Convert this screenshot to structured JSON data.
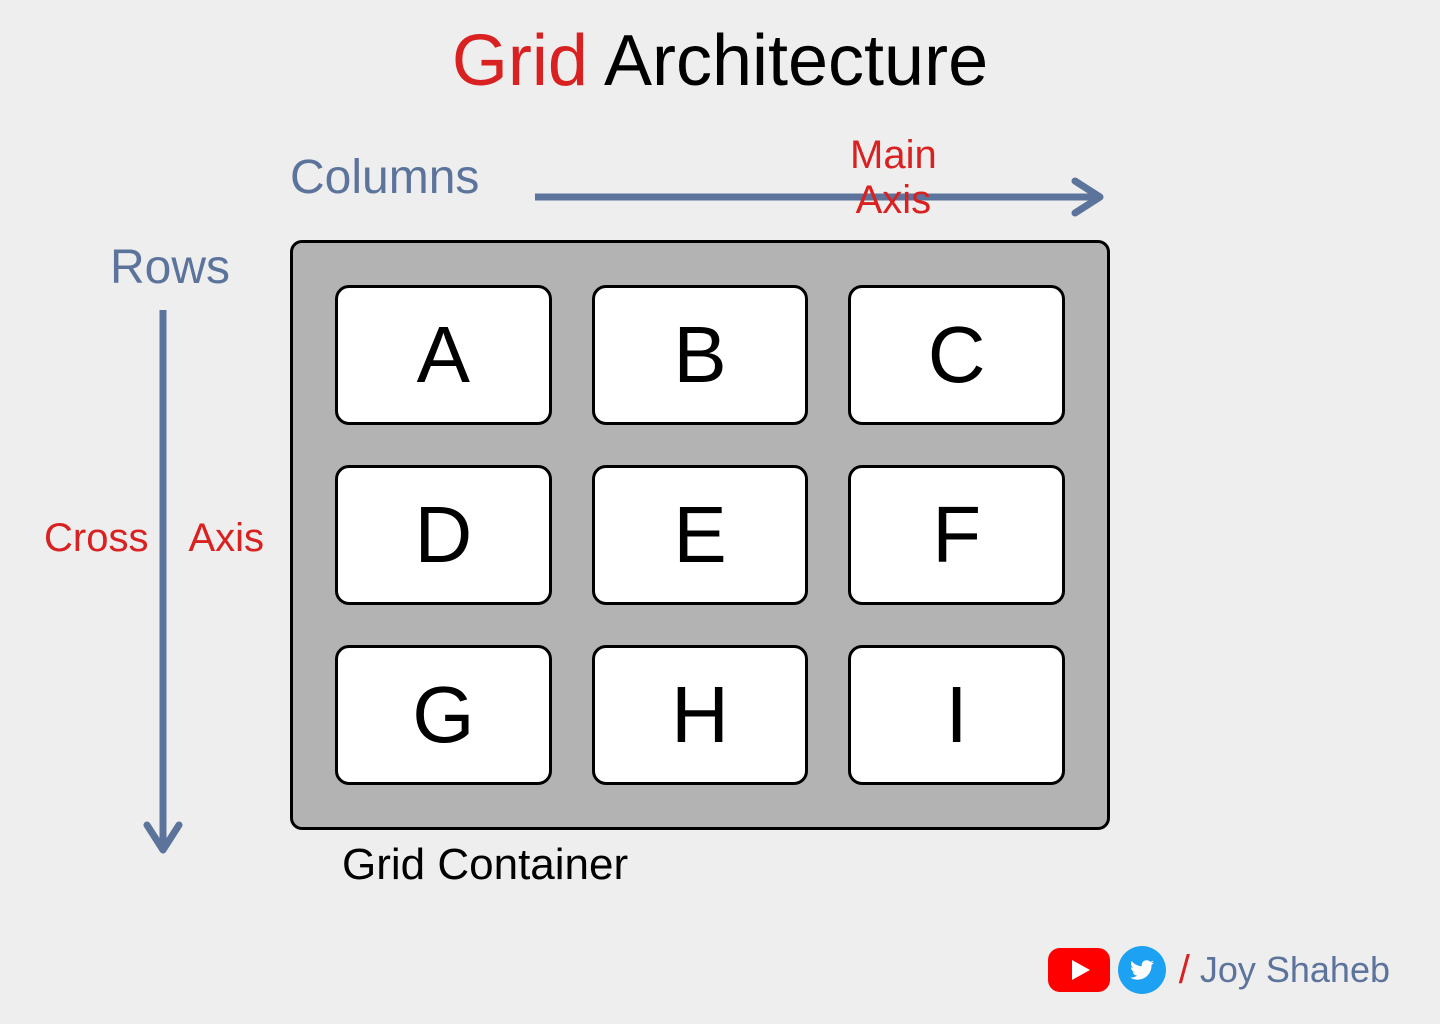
{
  "title": {
    "accent": "Grid",
    "rest": " Architecture"
  },
  "labels": {
    "columns": "Columns",
    "rows": "Rows",
    "main_axis_line1": "Main",
    "main_axis_line2": "Axis",
    "cross_axis_left": "Cross",
    "cross_axis_right": "Axis",
    "container": "Grid Container"
  },
  "grid": {
    "items": [
      "A",
      "B",
      "C",
      "D",
      "E",
      "F",
      "G",
      "H",
      "I"
    ]
  },
  "credits": {
    "slash": "/",
    "name": "Joy Shaheb"
  },
  "colors": {
    "accent_red": "#d92121",
    "blue_gray": "#5c749c",
    "grid_bg": "#b3b3b3",
    "youtube_red": "#ff0000",
    "twitter_blue": "#1da1f2"
  }
}
